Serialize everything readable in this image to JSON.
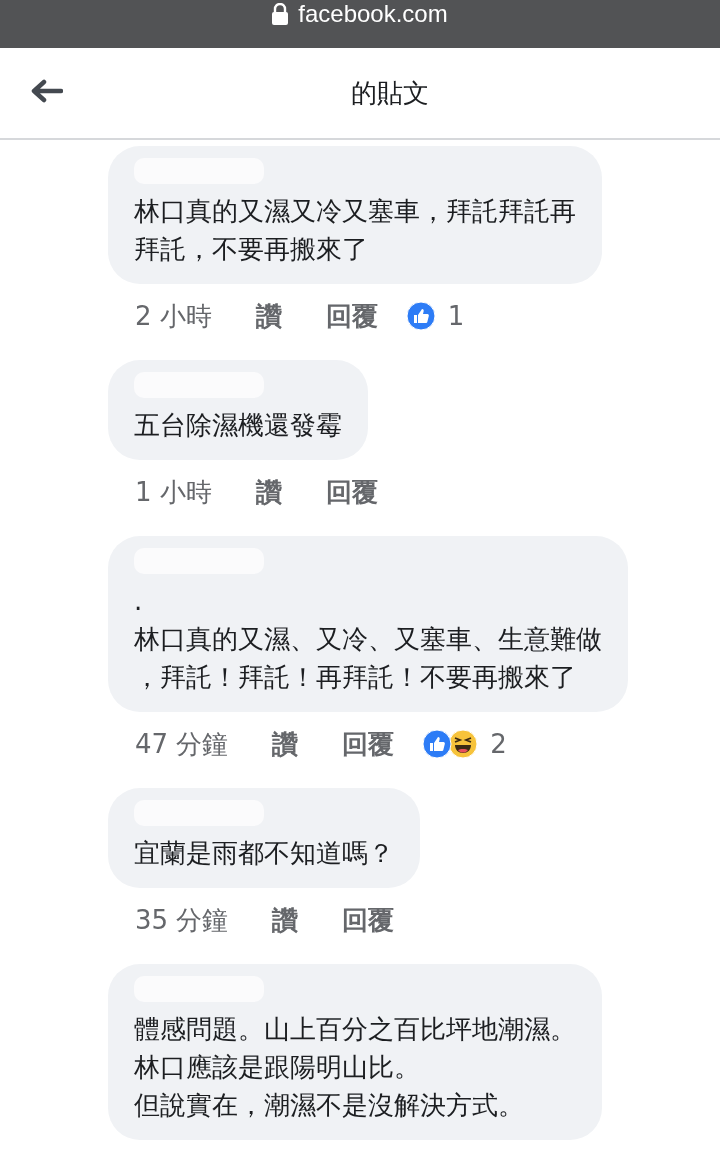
{
  "browser_bar": {
    "url": "facebook.com"
  },
  "header": {
    "title": "的貼文"
  },
  "comments": [
    {
      "lines": [
        "林口真的又濕又冷又塞車，拜託拜託再",
        "拜託，不要再搬來了"
      ],
      "time": "2 小時",
      "like": "讚",
      "reply": "回覆",
      "reactions": [
        {
          "kind": "like"
        }
      ],
      "reaction_count": "1"
    },
    {
      "lines": [
        "五台除濕機還發霉"
      ],
      "time": "1 小時",
      "like": "讚",
      "reply": "回覆"
    },
    {
      "lines": [
        ".",
        "林口真的又濕、又冷、又塞車、生意難做",
        "，拜託！拜託！再拜託！不要再搬來了"
      ],
      "time": "47 分鐘",
      "like": "讚",
      "reply": "回覆",
      "reactions": [
        {
          "kind": "like"
        },
        {
          "kind": "haha"
        }
      ],
      "reaction_count": "2"
    },
    {
      "lines": [
        "宜蘭是雨都不知道嗎？"
      ],
      "time": "35 分鐘",
      "like": "讚",
      "reply": "回覆"
    },
    {
      "lines": [
        "體感問題。山上百分之百比坪地潮濕。",
        "林口應該是跟陽明山比。",
        "但說實在，潮濕不是沒解決方式。"
      ]
    }
  ]
}
